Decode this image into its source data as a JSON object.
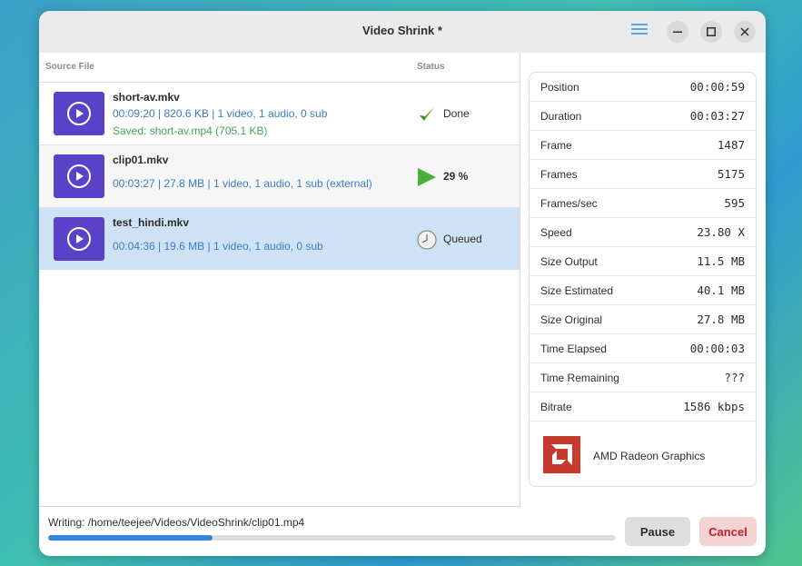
{
  "window": {
    "title": "Video Shrink *"
  },
  "list": {
    "headers": {
      "source": "Source File",
      "status": "Status"
    },
    "items": [
      {
        "name": "short-av.mkv",
        "meta": "00:09:20 | 820.6 KB | 1 video, 1 audio, 0 sub",
        "saved": "Saved: short-av.mp4 (705.1 KB)",
        "status": "Done",
        "status_icon": "checkmark-icon"
      },
      {
        "name": "clip01.mkv",
        "meta": "00:03:27 | 27.8 MB | 1 video, 1 audio, 1 sub (external)",
        "status": "29 %",
        "status_icon": "play-triangle-icon"
      },
      {
        "name": "test_hindi.mkv",
        "meta": "00:04:36 | 19.6 MB | 1 video, 1 audio, 0 sub",
        "status": "Queued",
        "status_icon": "clock-icon"
      }
    ]
  },
  "stats": [
    {
      "label": "Position",
      "value": "00:00:59"
    },
    {
      "label": "Duration",
      "value": "00:03:27"
    },
    {
      "label": "Frame",
      "value": "1487"
    },
    {
      "label": "Frames",
      "value": "5175"
    },
    {
      "label": "Frames/sec",
      "value": "595"
    },
    {
      "label": "Speed",
      "value": "23.80 X"
    },
    {
      "label": "Size Output",
      "value": "11.5 MB"
    },
    {
      "label": "Size Estimated",
      "value": "40.1 MB"
    },
    {
      "label": "Size Original",
      "value": "27.8 MB"
    },
    {
      "label": "Time Elapsed",
      "value": "00:00:03"
    },
    {
      "label": "Time Remaining",
      "value": "???"
    },
    {
      "label": "Bitrate",
      "value": "1586 kbps"
    }
  ],
  "gpu": {
    "name": "AMD Radeon Graphics",
    "logo": "amd-logo-icon"
  },
  "footer": {
    "writing": "Writing: /home/teejee/Videos/VideoShrink/clip01.mp4",
    "progress": 0.29,
    "pause_label": "Pause",
    "cancel_label": "Cancel"
  },
  "colors": {
    "accent": "#3584e4",
    "thumb": "#5a42c8",
    "meta_text": "#3b7cc4",
    "saved_text": "#3fa55a",
    "selected_row": "#cfe1f5",
    "cancel_text": "#c01c28",
    "amd_red": "#c93a2e"
  }
}
